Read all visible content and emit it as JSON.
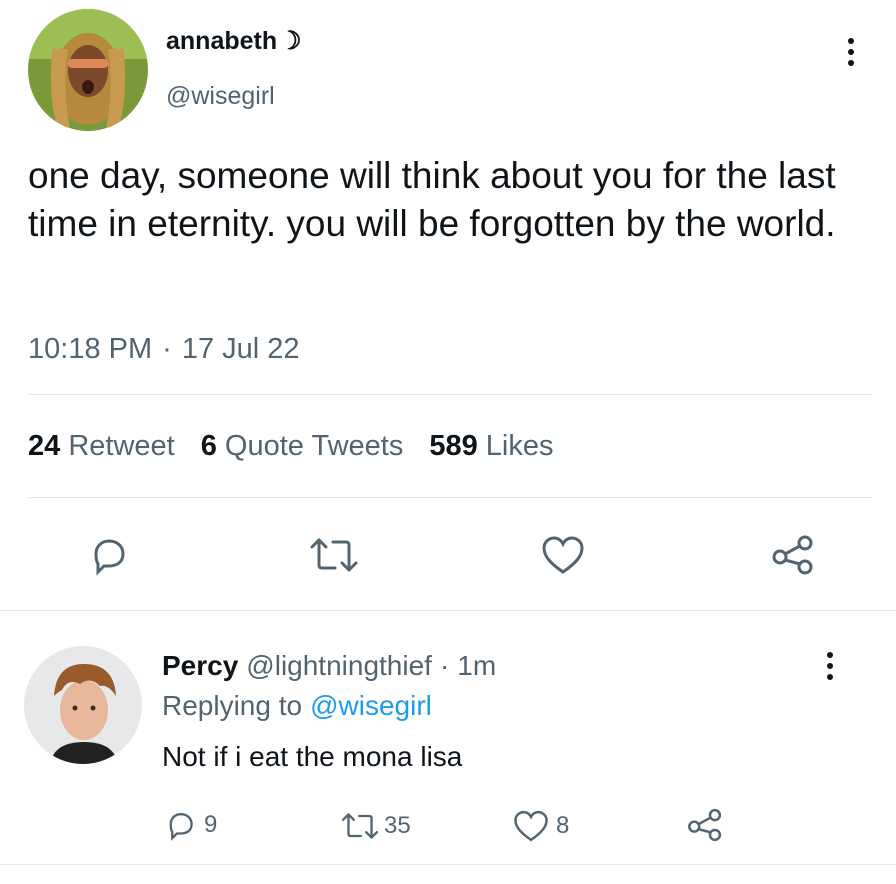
{
  "tweet": {
    "display_name": "annabeth",
    "name_emoji": "☽",
    "handle": "@wisegirl",
    "text": "one day, someone will think about you for the last time in eternity. you will be forgotten by the world.",
    "time": "10:18 PM",
    "dot": "·",
    "date": "17 Jul 22",
    "stats": {
      "retweets_count": "24",
      "retweets_label": "Retweet",
      "quotes_count": "6",
      "quotes_label": "Quote Tweets",
      "likes_count": "589",
      "likes_label": "Likes"
    }
  },
  "reply": {
    "display_name": "Percy",
    "handle": "@lightningthief",
    "dot": "·",
    "time": "1m",
    "replying_label": "Replying to",
    "replying_handle": "@wisegirl",
    "text": "Not if i eat the mona lisa",
    "counts": {
      "replies": "9",
      "retweets": "35",
      "likes": "8"
    }
  },
  "icons": [
    "more-icon",
    "reply-icon",
    "retweet-icon",
    "like-icon",
    "share-icon"
  ],
  "colors": {
    "link": "#1d9bf0",
    "muted": "#536471",
    "text": "#0f1419"
  }
}
